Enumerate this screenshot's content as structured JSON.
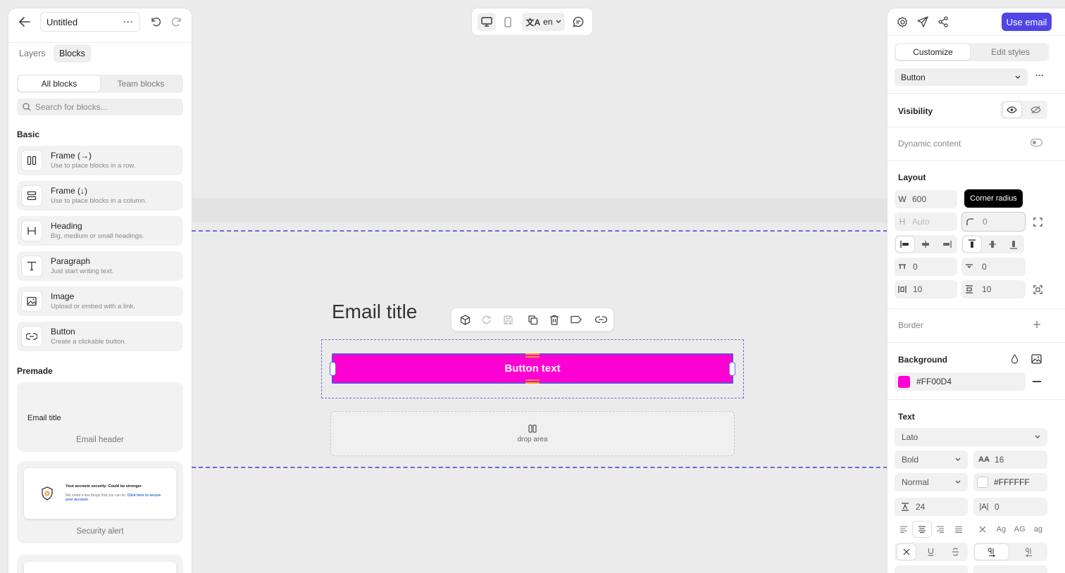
{
  "document": {
    "title": "Untitled"
  },
  "left_panel": {
    "tabs": [
      "Layers",
      "Blocks"
    ],
    "block_filters": [
      "All blocks",
      "Team blocks"
    ],
    "search_placeholder": "Search for blocks...",
    "basic_label": "Basic",
    "blocks": [
      {
        "title": "Frame (→)",
        "desc": "Use to place blocks in a row.",
        "icon": "columns-icon"
      },
      {
        "title": "Frame (↓)",
        "desc": "Use to place blocks in a column.",
        "icon": "rows-icon"
      },
      {
        "title": "Heading",
        "desc": "Big, medium or small headings.",
        "icon": "heading-icon"
      },
      {
        "title": "Paragraph",
        "desc": "Just start writing text.",
        "icon": "text-icon"
      },
      {
        "title": "Image",
        "desc": "Upload or embed with a link.",
        "icon": "image-icon"
      },
      {
        "title": "Button",
        "desc": "Create a clickable button.",
        "icon": "link-icon"
      }
    ],
    "premade_label": "Premade",
    "premade": [
      {
        "preview_text": "Email title",
        "label": "Email header"
      },
      {
        "preview_title": "Your account security: Could be stronger",
        "preview_body": "We noted a few things that you can do.",
        "preview_link": "Click here to secure your account.",
        "label": "Security alert"
      }
    ]
  },
  "toolbar": {
    "language": "en"
  },
  "canvas": {
    "email_title": "Email title",
    "button_text": "Button text",
    "drop_area": "drop area"
  },
  "right_panel": {
    "use_email": "Use email",
    "tabs": [
      "Customize",
      "Edit styles"
    ],
    "element_select": "Button",
    "visibility_label": "Visibility",
    "dynamic_label": "Dynamic content",
    "layout_label": "Layout",
    "width": {
      "key": "W",
      "value": "600"
    },
    "height": {
      "key": "H",
      "placeholder": "Auto"
    },
    "corner_radius": "0",
    "tooltip": "Corner radius",
    "spacing_a": "0",
    "spacing_b": "0",
    "padding_x": "10",
    "padding_y": "10",
    "border_label": "Border",
    "background_label": "Background",
    "background_color": "#FF00D4",
    "text_label": "Text",
    "font": "Lato",
    "weight": "Bold",
    "font_size": "16",
    "style": "Normal",
    "text_color": "#FFFFFF",
    "line_height": "24",
    "letter_spacing": "0",
    "case_options": [
      "Ag",
      "AG",
      "ag"
    ]
  },
  "colors": {
    "accent": "#4f46e5",
    "button_bg": "#ff00d4",
    "selection": "#6b6bdc"
  }
}
